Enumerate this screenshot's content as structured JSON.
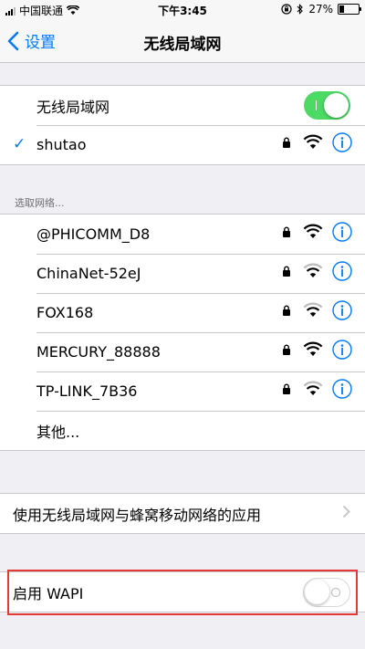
{
  "status_bar": {
    "carrier": "中国联通",
    "time": "下午3:45",
    "battery_percent": "27%",
    "battery_level": 0.27
  },
  "nav": {
    "back_label": "设置",
    "title": "无线局域网"
  },
  "wifi_toggle": {
    "label": "无线局域网",
    "state": "on"
  },
  "connected_network": {
    "name": "shutao",
    "checked": true,
    "secured": true
  },
  "choose_network": {
    "header": "选取网络...",
    "networks": [
      {
        "name": "@PHICOMM_D8",
        "secured": true
      },
      {
        "name": "ChinaNet-52eJ",
        "secured": true
      },
      {
        "name": "FOX168",
        "secured": true
      },
      {
        "name": "MERCURY_88888",
        "secured": true
      },
      {
        "name": "TP-LINK_7B36",
        "secured": true
      }
    ],
    "other_label": "其他..."
  },
  "apps_using_wlan": {
    "label": "使用无线局域网与蜂窝移动网络的应用"
  },
  "wapi": {
    "label": "启用 WAPI",
    "state": "off"
  },
  "colors": {
    "accent": "#007aff",
    "toggle_on": "#4cd964",
    "highlight": "#e53935",
    "background": "#efeff4"
  }
}
